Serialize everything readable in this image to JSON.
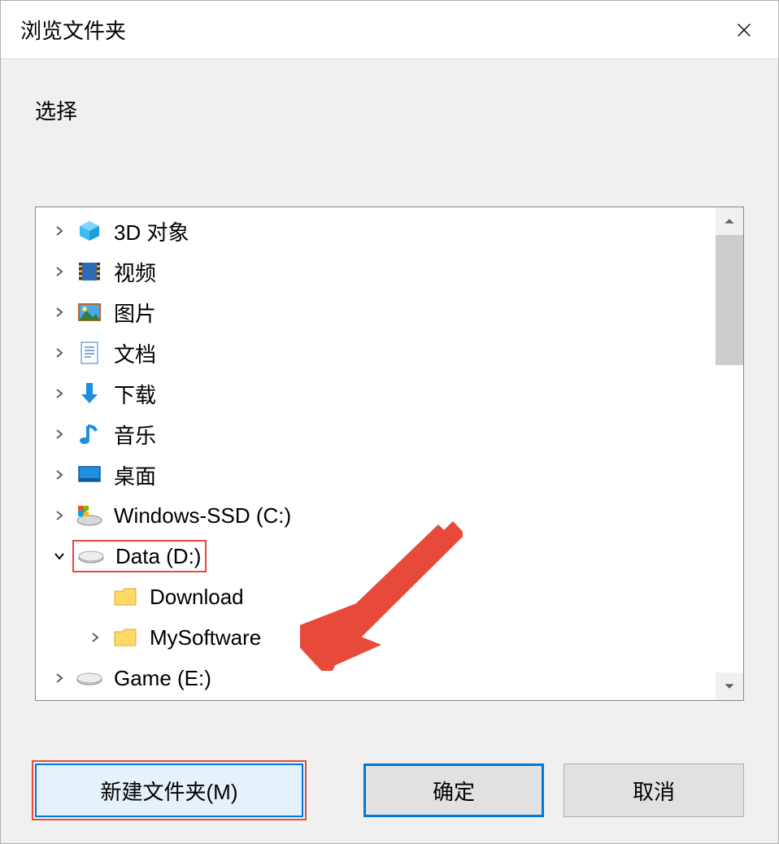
{
  "dialog": {
    "title": "浏览文件夹",
    "instruction": "选择"
  },
  "tree": [
    {
      "label": "3D 对象",
      "icon": "3d-objects",
      "level": 0,
      "expander": "right",
      "highlighted": false
    },
    {
      "label": "视频",
      "icon": "videos",
      "level": 0,
      "expander": "right",
      "highlighted": false
    },
    {
      "label": "图片",
      "icon": "pictures",
      "level": 0,
      "expander": "right",
      "highlighted": false
    },
    {
      "label": "文档",
      "icon": "documents",
      "level": 0,
      "expander": "right",
      "highlighted": false
    },
    {
      "label": "下载",
      "icon": "downloads",
      "level": 0,
      "expander": "right",
      "highlighted": false
    },
    {
      "label": "音乐",
      "icon": "music",
      "level": 0,
      "expander": "right",
      "highlighted": false
    },
    {
      "label": "桌面",
      "icon": "desktop",
      "level": 0,
      "expander": "right",
      "highlighted": false
    },
    {
      "label": "Windows-SSD (C:)",
      "icon": "drive-win",
      "level": 0,
      "expander": "right",
      "highlighted": false
    },
    {
      "label": "Data (D:)",
      "icon": "drive",
      "level": 0,
      "expander": "down",
      "highlighted": true
    },
    {
      "label": "Download",
      "icon": "folder",
      "level": 1,
      "expander": "none",
      "highlighted": false
    },
    {
      "label": "MySoftware",
      "icon": "folder",
      "level": 1,
      "expander": "right",
      "highlighted": false
    },
    {
      "label": "Game (E:)",
      "icon": "drive",
      "level": 0,
      "expander": "right",
      "highlighted": false
    }
  ],
  "buttons": {
    "new_folder": "新建文件夹(M)",
    "ok": "确定",
    "cancel": "取消"
  },
  "annotation": {
    "arrow_color": "#e74a3a",
    "target": "new_folder_button"
  }
}
